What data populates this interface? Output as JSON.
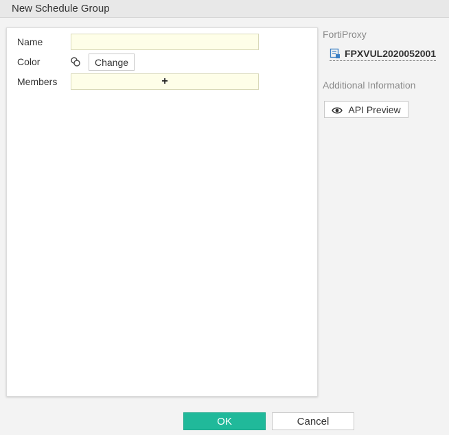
{
  "dialog": {
    "title": "New Schedule Group"
  },
  "form": {
    "name_label": "Name",
    "name_value": "",
    "color_label": "Color",
    "color_icon": "color-palette-icon",
    "change_label": "Change",
    "members_label": "Members",
    "members_add_glyph": "+"
  },
  "sidebar": {
    "device_heading": "FortiProxy",
    "device_name": "FPXVUL2020052001",
    "device_icon": "device-icon",
    "info_heading": "Additional Information",
    "api_preview_label": "API Preview",
    "api_preview_icon": "eye-icon"
  },
  "footer": {
    "ok_label": "OK",
    "cancel_label": "Cancel"
  },
  "colors": {
    "accent": "#20b99a",
    "input_bg": "#fefee8"
  }
}
